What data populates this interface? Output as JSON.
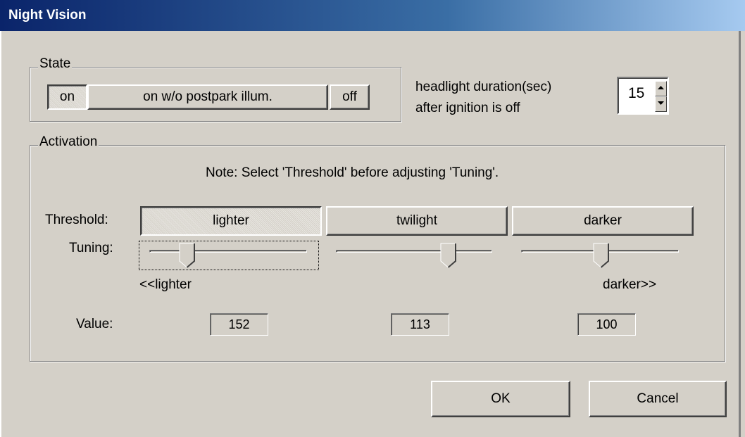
{
  "window": {
    "title": "Night Vision"
  },
  "state": {
    "legend": "State",
    "buttons": {
      "on": "on",
      "on_wo": "on w/o postpark illum.",
      "off": "off"
    },
    "selected": "on"
  },
  "headlight": {
    "line1": "headlight duration(sec)",
    "line2": "after ignition is off",
    "value": "15"
  },
  "activation": {
    "legend": "Activation",
    "note": "Note: Select 'Threshold' before adjusting 'Tuning'.",
    "threshold_label": "Threshold:",
    "tuning_label": "Tuning:",
    "value_label": "Value:",
    "lighter_hint": "<<lighter",
    "darker_hint": "darker>>",
    "columns": [
      {
        "threshold": "lighter",
        "value": "152",
        "tuning_fraction": 0.24
      },
      {
        "threshold": "twilight",
        "value": "113",
        "tuning_fraction": 0.72
      },
      {
        "threshold": "darker",
        "value": "100",
        "tuning_fraction": 0.51
      }
    ],
    "selected_threshold": "lighter"
  },
  "footer": {
    "ok": "OK",
    "cancel": "Cancel"
  }
}
